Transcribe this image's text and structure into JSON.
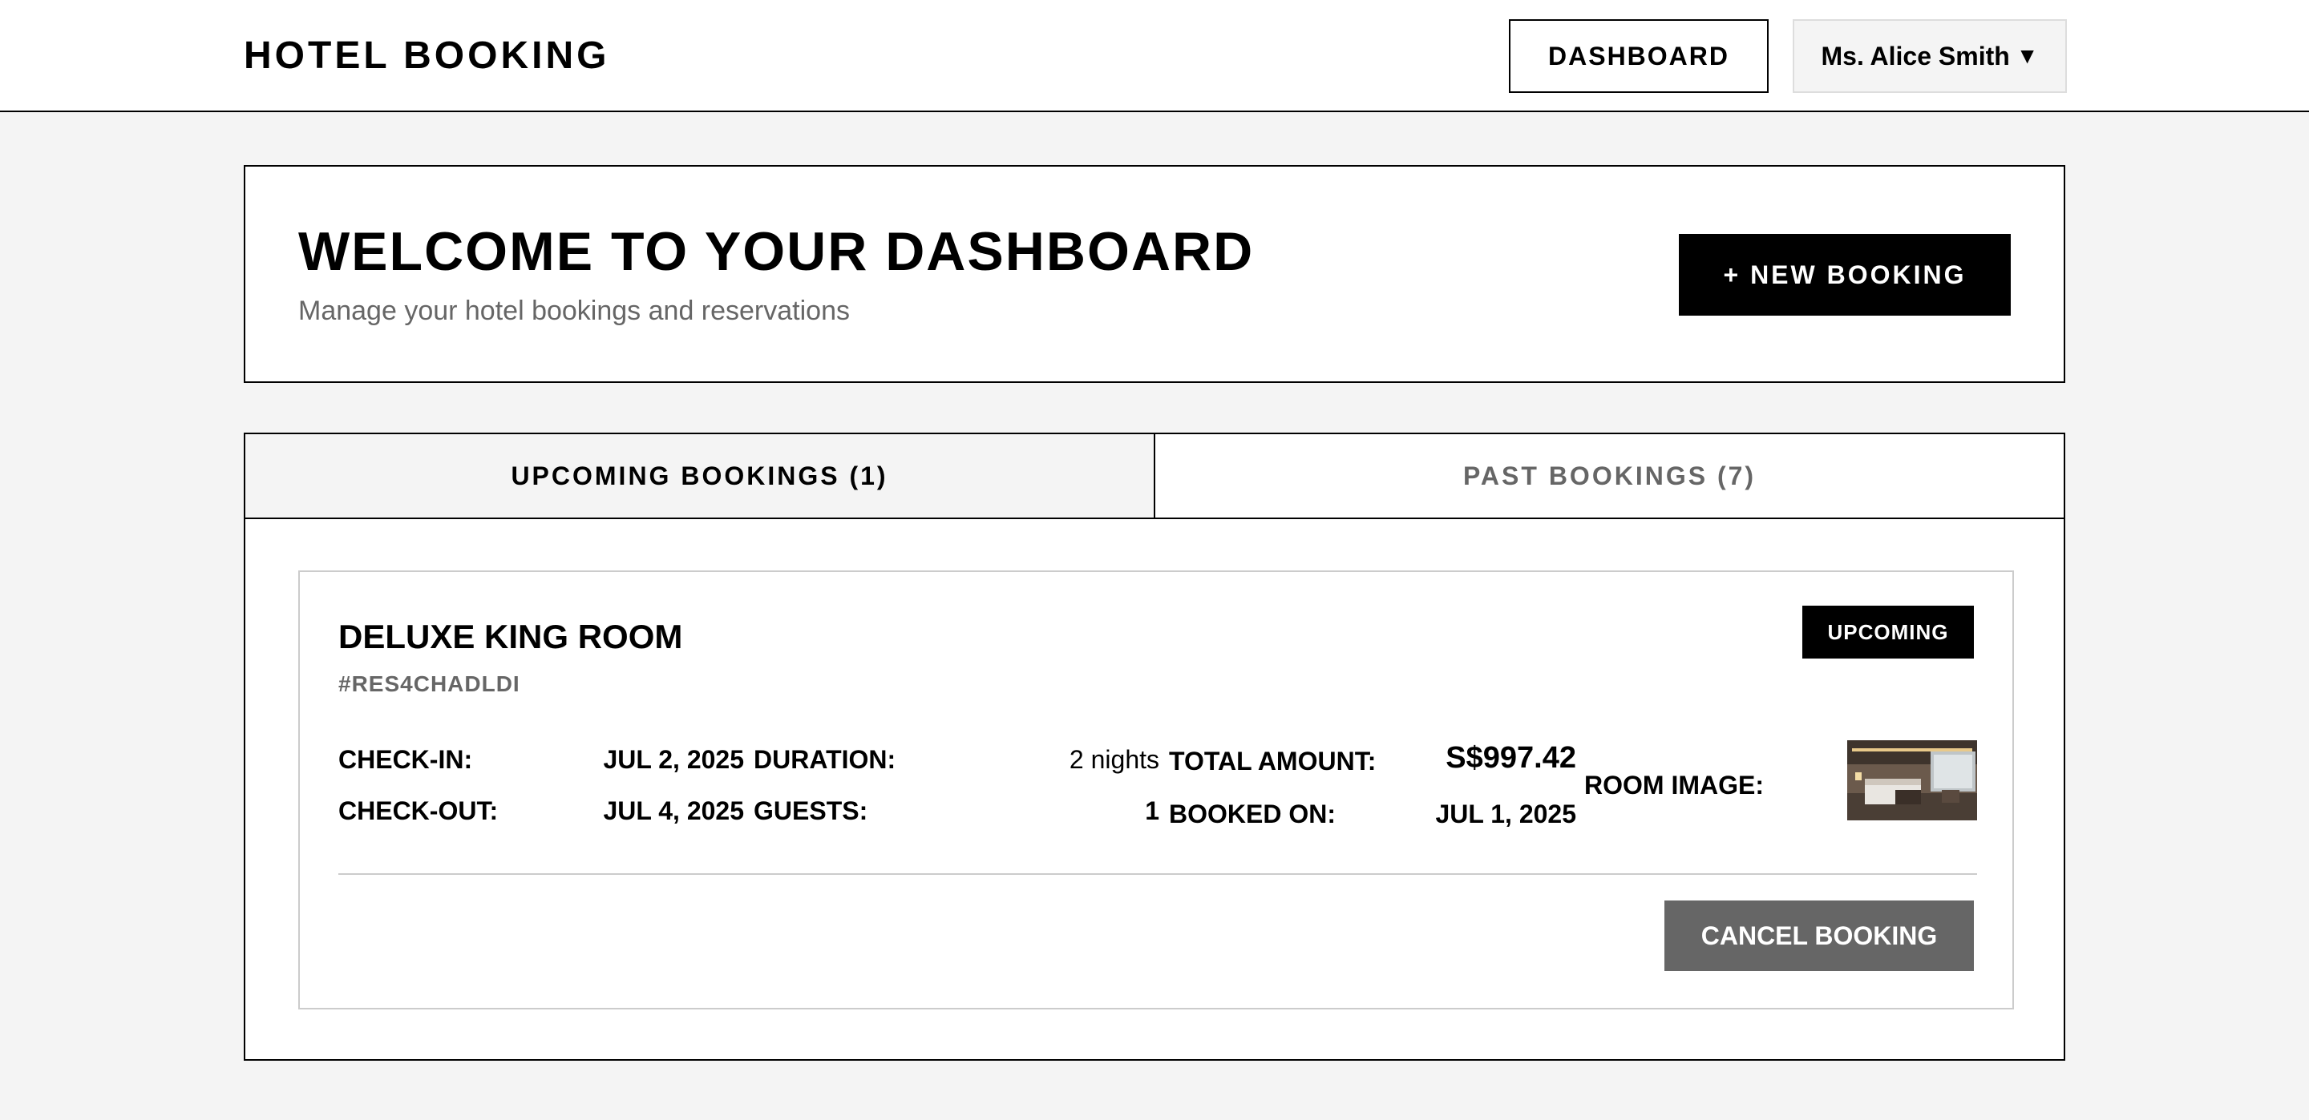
{
  "header": {
    "brand": "HOTEL BOOKING",
    "dashboard_label": "DASHBOARD",
    "user_name": "Ms. Alice Smith",
    "user_caret": "▼"
  },
  "welcome": {
    "title": "WELCOME TO YOUR DASHBOARD",
    "subtitle": "Manage your hotel bookings and reservations",
    "new_booking_label": "+ NEW BOOKING"
  },
  "tabs": [
    {
      "label": "UPCOMING BOOKINGS (1)",
      "active": true
    },
    {
      "label": "PAST BOOKINGS (7)",
      "active": false
    }
  ],
  "booking": {
    "room_name": "DELUXE KING ROOM",
    "reservation_code": "#RES4CHADLDI",
    "status": "UPCOMING",
    "checkin_label": "CHECK-IN:",
    "checkin_value": "JUL 2, 2025",
    "checkout_label": "CHECK-OUT:",
    "checkout_value": "JUL 4, 2025",
    "duration_label": "DURATION:",
    "duration_value": "2 nights",
    "guests_label": "GUESTS:",
    "guests_value": "1",
    "total_label": "TOTAL AMOUNT:",
    "total_value": "S$997.42",
    "booked_label": "BOOKED ON:",
    "booked_value": "JUL 1, 2025",
    "image_label": "ROOM IMAGE:",
    "cancel_label": "CANCEL BOOKING"
  },
  "colors": {
    "accent": "#000000",
    "muted": "#666666",
    "background": "#f4f4f4",
    "border_light": "#cccccc"
  }
}
